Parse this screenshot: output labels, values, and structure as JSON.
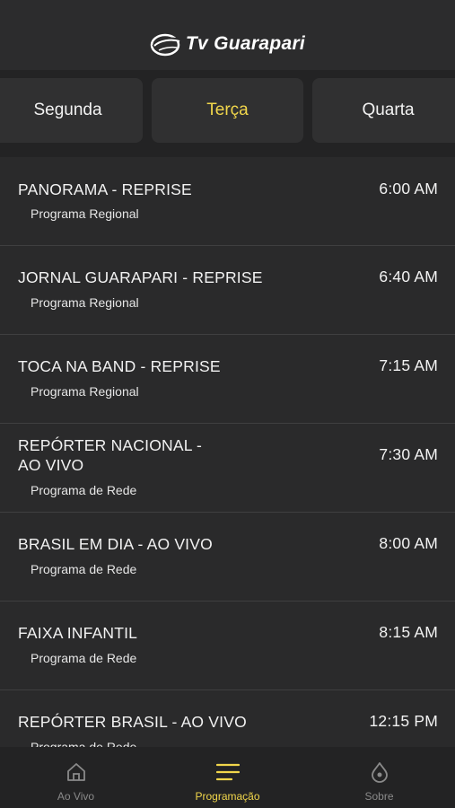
{
  "header": {
    "logo_text": "Tv Guarapari"
  },
  "days": [
    {
      "label": "Segunda",
      "active": false
    },
    {
      "label": "Terça",
      "active": true
    },
    {
      "label": "Quarta",
      "active": false
    }
  ],
  "schedule": [
    {
      "title": "PANORAMA - REPRISE",
      "type": "Programa Regional",
      "time": "6:00 AM"
    },
    {
      "title": "JORNAL GUARAPARI - REPRISE",
      "type": "Programa Regional",
      "time": "6:40 AM"
    },
    {
      "title": "TOCA NA BAND - REPRISE",
      "type": "Programa Regional",
      "time": "7:15 AM"
    },
    {
      "title": "REPÓRTER NACIONAL - AO VIVO",
      "type": "Programa de Rede",
      "time": "7:30 AM"
    },
    {
      "title": "BRASIL EM DIA - AO VIVO",
      "type": "Programa de Rede",
      "time": "8:00 AM"
    },
    {
      "title": "FAIXA INFANTIL",
      "type": "Programa de Rede",
      "time": "8:15 AM"
    },
    {
      "title": "REPÓRTER BRASIL - AO VIVO",
      "type": "Programa de Rede",
      "time": "12:15 PM"
    }
  ],
  "tabbar": [
    {
      "label": "Ao Vivo",
      "icon": "home-icon",
      "active": false
    },
    {
      "label": "Programação",
      "icon": "menu-lines-icon",
      "active": true
    },
    {
      "label": "Sobre",
      "icon": "drop-icon",
      "active": false
    }
  ],
  "colors": {
    "accent": "#f1d64b",
    "background": "#2a2a2b",
    "bar": "#232324",
    "tab_inactive": "#8a8a8a"
  }
}
